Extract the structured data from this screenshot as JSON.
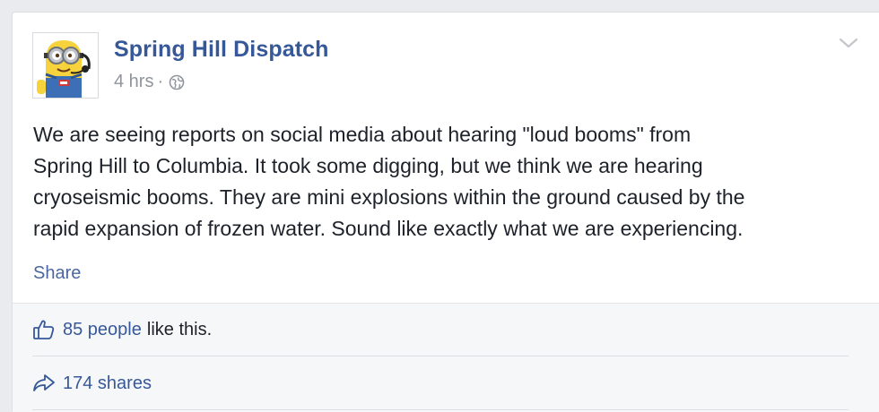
{
  "post": {
    "page_name": "Spring Hill Dispatch",
    "time": "4 hrs",
    "separator": "·",
    "audience_icon": "globe-icon",
    "options_icon": "chevron-down-icon",
    "text_lines": [
      "We are seeing reports on social media about hearing \"loud booms\" from",
      "Spring Hill to Columbia. It took some digging, but we think we are hearing",
      "cryoseismic booms. They are mini explosions within the ground caused by the",
      "rapid expansion of frozen water. Sound like exactly what we are experiencing."
    ],
    "share_label": "Share"
  },
  "ufi": {
    "likes_icon": "thumbs-up-icon",
    "likes_link": "85 people",
    "likes_rest": "like this.",
    "shares_icon": "share-arrow-icon",
    "shares_label": "174 shares"
  },
  "colors": {
    "link": "#365899",
    "text": "#1d2129",
    "meta": "#90949c",
    "ufi_background": "#f6f7f9"
  }
}
